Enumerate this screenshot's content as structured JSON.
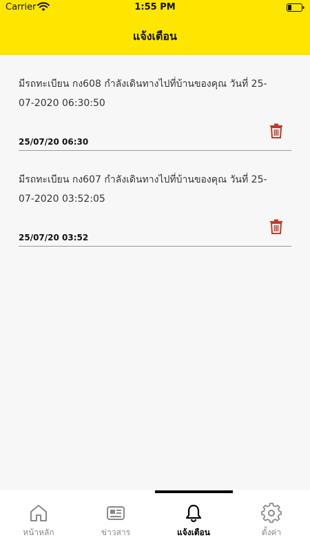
{
  "status_bar": {
    "carrier": "Carrier",
    "time": "1:55 PM"
  },
  "header": {
    "title": "แจ้งเตือน"
  },
  "notifications": [
    {
      "message": "มีรถทะเบียน กง608 กำลังเดินทางไปที่บ้านของคุณ วันที่ 25-07-2020 06:30:50",
      "date": "25/07/20 06:30"
    },
    {
      "message": "มีรถทะเบียน กง607 กำลังเดินทางไปที่บ้านของคุณ วันที่ 25-07-2020 03:52:05",
      "date": "25/07/20 03:52"
    }
  ],
  "tabs": [
    {
      "label": "หน้าหลัก",
      "icon": "home-icon"
    },
    {
      "label": "ข่าวสาร",
      "icon": "news-icon"
    },
    {
      "label": "แจ้งเตือน",
      "icon": "bell-icon"
    },
    {
      "label": "ตั้งค่า",
      "icon": "gear-icon"
    }
  ],
  "colors": {
    "header_bg": "#ffe600",
    "trash": "#c0392b",
    "active_tab": "#000000",
    "inactive_tab": "#888888"
  }
}
